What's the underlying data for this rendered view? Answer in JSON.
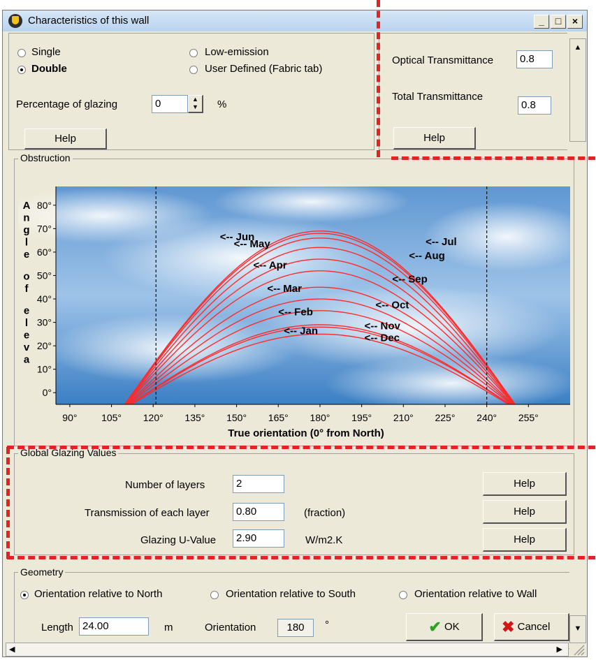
{
  "window": {
    "title": "Characteristics of this wall",
    "minimize": "_",
    "maximize": "□",
    "close": "×"
  },
  "glazing_type": {
    "single": "Single",
    "double": "Double",
    "low_emission": "Low-emission",
    "user_defined": "User Defined (Fabric tab)",
    "percentage_label": "Percentage of glazing",
    "percentage_value": "0",
    "percent_unit": "%",
    "help": "Help"
  },
  "transmittance": {
    "optical_label": "Optical Transmittance",
    "optical_value": "0.8",
    "total_label": "Total Transmittance",
    "total_value": "0.8",
    "help": "Help"
  },
  "obstruction": {
    "title": "Obstruction",
    "chart_data": {
      "type": "line",
      "xlabel": "True orientation (0° from North)",
      "ylabel": "Angle of eleva",
      "x_ticks": [
        "90°",
        "105°",
        "120°",
        "135°",
        "150°",
        "165°",
        "180°",
        "195°",
        "210°",
        "225°",
        "240°",
        "255°"
      ],
      "y_ticks": [
        "0°",
        "10°",
        "20°",
        "30°",
        "40°",
        "50°",
        "60°",
        "70°",
        "80°"
      ],
      "xlim": [
        85,
        270
      ],
      "ylim": [
        -5,
        88
      ],
      "vlines": [
        121,
        240
      ],
      "months": [
        {
          "name": "Jun",
          "peak": 69,
          "label": "<-- Jun",
          "lx": 144,
          "ly": 65
        },
        {
          "name": "Jul",
          "peak": 68,
          "label": "<-- Jul",
          "lx": 218,
          "ly": 63
        },
        {
          "name": "May",
          "peak": 66,
          "label": "<-- May",
          "lx": 149,
          "ly": 62
        },
        {
          "name": "Aug",
          "peak": 62,
          "label": "<-- Aug",
          "lx": 212,
          "ly": 57
        },
        {
          "name": "Apr",
          "peak": 57,
          "label": "<-- Apr",
          "lx": 156,
          "ly": 53
        },
        {
          "name": "Sep",
          "peak": 52,
          "label": "<-- Sep",
          "lx": 206,
          "ly": 47
        },
        {
          "name": "Mar",
          "peak": 45,
          "label": "<-- Mar",
          "lx": 161,
          "ly": 43
        },
        {
          "name": "Oct",
          "peak": 40,
          "label": "<-- Oct",
          "lx": 200,
          "ly": 36
        },
        {
          "name": "Feb",
          "peak": 35,
          "label": "<-- Feb",
          "lx": 165,
          "ly": 33
        },
        {
          "name": "Nov",
          "peak": 29,
          "label": "<-- Nov",
          "lx": 196,
          "ly": 27
        },
        {
          "name": "Jan",
          "peak": 28,
          "label": "<-- Jan",
          "lx": 167,
          "ly": 25
        },
        {
          "name": "Dec",
          "peak": 25,
          "label": "<-- Dec",
          "lx": 196,
          "ly": 22
        }
      ]
    }
  },
  "global_glazing": {
    "title": "Global Glazing Values",
    "layers_label": "Number of layers",
    "layers_value": "2",
    "transmission_label": "Transmission of each layer",
    "transmission_value": "0.80",
    "transmission_unit": "(fraction)",
    "uvalue_label": "Glazing U-Value",
    "uvalue_value": "2.90",
    "uvalue_unit": "W/m2.K",
    "help": "Help"
  },
  "geometry": {
    "title": "Geometry",
    "rel_north": "Orientation relative to North",
    "rel_south": "Orientation relative to South",
    "rel_wall": "Orientation relative to Wall",
    "length_label": "Length",
    "length_value": "24.00",
    "length_unit": "m",
    "orientation_label": "Orientation",
    "orientation_value": "180",
    "orientation_unit": "°",
    "ok": "OK",
    "cancel": "Cancel"
  },
  "colors": {
    "curve": "#ff2a2a",
    "annotation_dash": "#e32222",
    "sky": "#4a86c8"
  }
}
